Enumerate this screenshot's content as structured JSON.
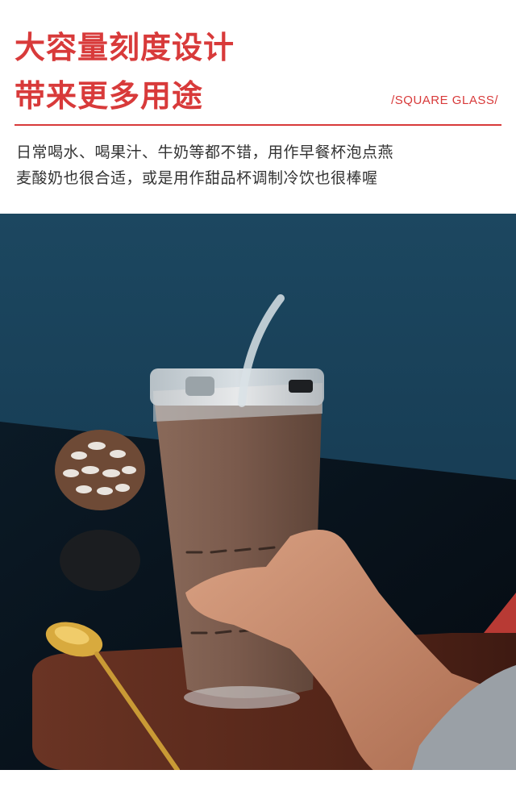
{
  "header": {
    "title_line_1": "大容量刻度设计",
    "title_line_2": "带来更多用途",
    "tagline": "/SQUARE GLASS/",
    "description_line_1": "日常喝水、喝果汁、牛奶等都不错，用作早餐杯泡点燕",
    "description_line_2": "麦酸奶也很合适，或是用作甜品杯调制冷饮也很棒喔"
  },
  "colors": {
    "accent": "#d83a3a",
    "background_wall": "#163a4e",
    "table_dark": "#0a121c",
    "board_wood": "#5a2a1e",
    "coffee": "#7a5b4d"
  },
  "photo": {
    "icons": [
      "glass-cup-icon",
      "straw-icon",
      "pinecone-icon",
      "gold-spoon-icon",
      "wooden-board-icon",
      "hand-icon"
    ]
  }
}
